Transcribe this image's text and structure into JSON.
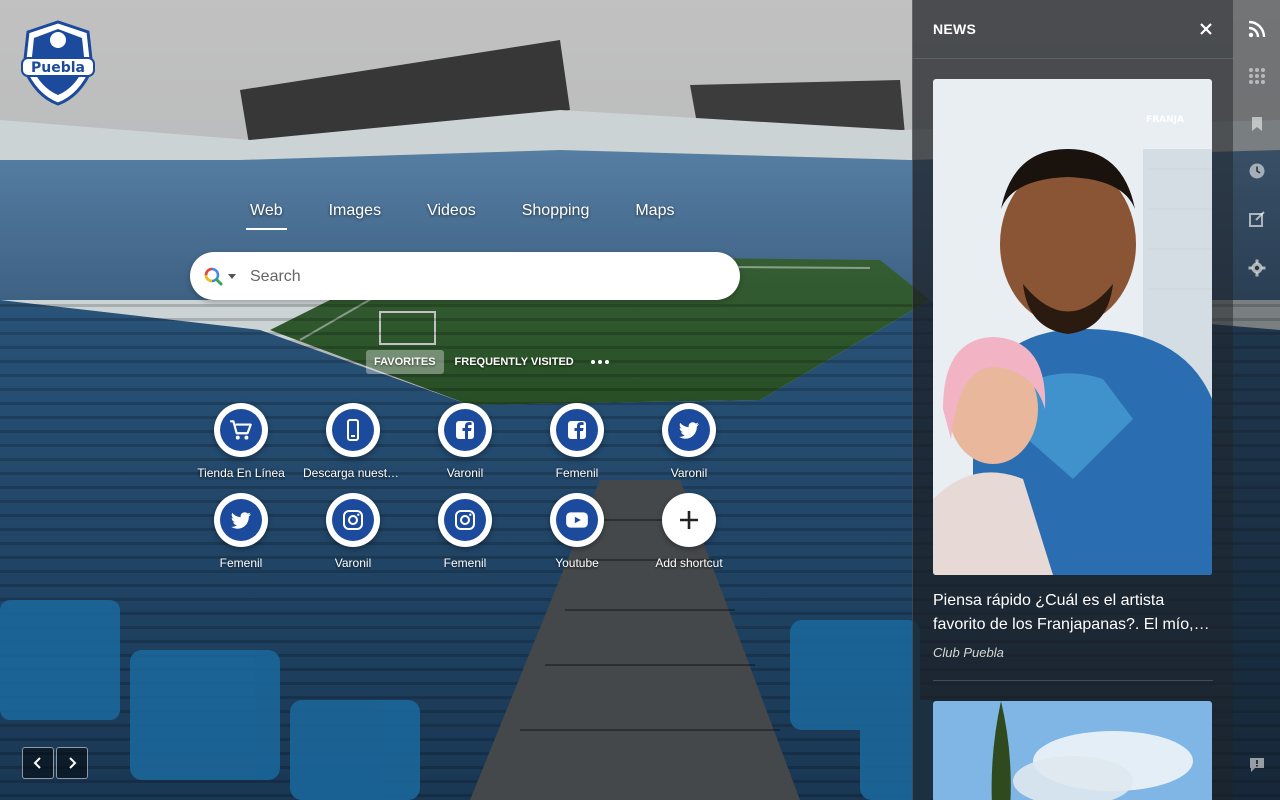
{
  "search": {
    "tabs": [
      {
        "label": "Web",
        "active": true
      },
      {
        "label": "Images"
      },
      {
        "label": "Videos"
      },
      {
        "label": "Shopping"
      },
      {
        "label": "Maps"
      }
    ],
    "placeholder": "Search",
    "engine_icon": "magnifier-multicolor-icon"
  },
  "shortcut_modes": {
    "favorites": "FAVORITES",
    "frequently_visited": "FREQUENTLY VISITED",
    "active": "FAVORITES"
  },
  "shortcuts": [
    {
      "label": "Tienda En Línea",
      "icon": "shopping-cart-icon"
    },
    {
      "label": "Descarga nuestra app",
      "icon": "mobile-phone-icon"
    },
    {
      "label": "Varonil",
      "icon": "facebook-icon"
    },
    {
      "label": "Femenil",
      "icon": "facebook-icon"
    },
    {
      "label": "Varonil",
      "icon": "twitter-icon"
    },
    {
      "label": "Femenil",
      "icon": "twitter-icon"
    },
    {
      "label": "Varonil",
      "icon": "instagram-icon"
    },
    {
      "label": "Femenil",
      "icon": "instagram-icon"
    },
    {
      "label": "Youtube",
      "icon": "youtube-icon"
    },
    {
      "label": "Add shortcut",
      "icon": "plus-icon"
    }
  ],
  "logo": {
    "text": "Puebla"
  },
  "news": {
    "title": "NEWS",
    "items": [
      {
        "title": "Piensa rápido  ¿Cuál es el artista favorito de los Franjapanas?. El mío, …",
        "source": "Club Puebla",
        "image_watermark": "FRANJA"
      }
    ]
  },
  "colors": {
    "brand_blue": "#1c4a9c",
    "panel_bg": "#1c1e22"
  }
}
